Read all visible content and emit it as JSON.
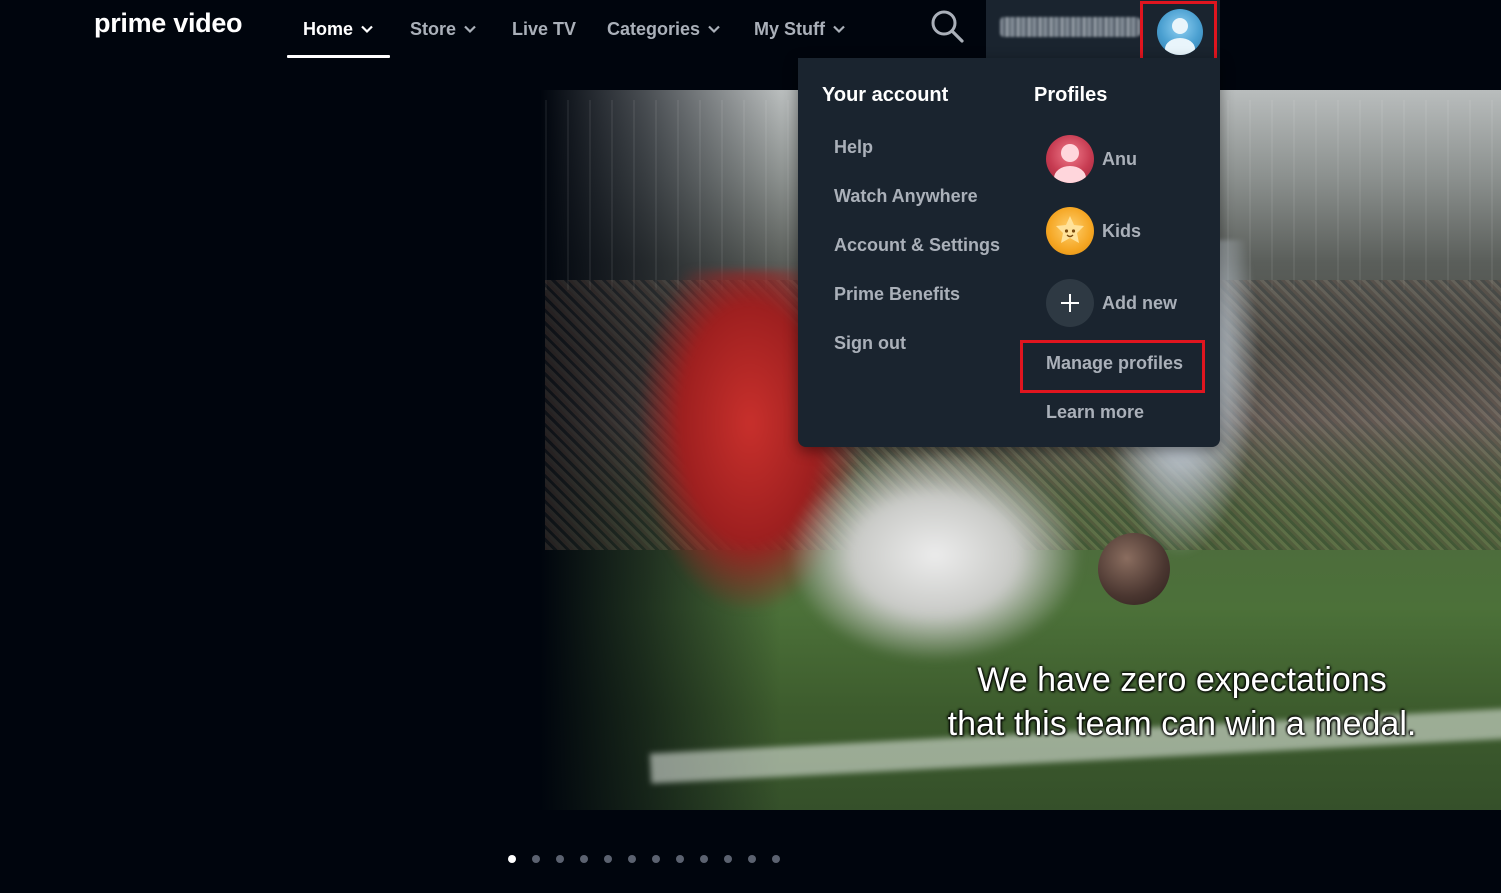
{
  "brand": {
    "logo_text": "prime video"
  },
  "nav": {
    "items": [
      {
        "label": "Home",
        "has_dropdown": true,
        "active": true
      },
      {
        "label": "Store",
        "has_dropdown": true
      },
      {
        "label": "Live TV",
        "has_dropdown": false
      },
      {
        "label": "Categories",
        "has_dropdown": true
      },
      {
        "label": "My Stuff",
        "has_dropdown": true
      }
    ],
    "search_icon": "search-icon"
  },
  "account_menu": {
    "your_account_heading": "Your account",
    "links": [
      "Help",
      "Watch Anywhere",
      "Account & Settings",
      "Prime Benefits",
      "Sign out"
    ],
    "profiles_heading": "Profiles",
    "profiles": [
      {
        "name": "Anu",
        "icon": "user-avatar-icon"
      },
      {
        "name": "Kids",
        "icon": "kids-avatar-icon"
      },
      {
        "name": "Add new",
        "icon": "plus-icon"
      }
    ],
    "manage_profiles": "Manage profiles",
    "learn_more": "Learn more"
  },
  "hero": {
    "subtitle_line1": "We have zero expectations",
    "subtitle_line2": "that this team can win a medal."
  },
  "carousel": {
    "total": 12,
    "active_index": 0
  },
  "colors": {
    "background": "#00050d",
    "menu_background": "#1a242f",
    "nav_text": "#aab0b9",
    "highlight_box": "#e0151f"
  }
}
